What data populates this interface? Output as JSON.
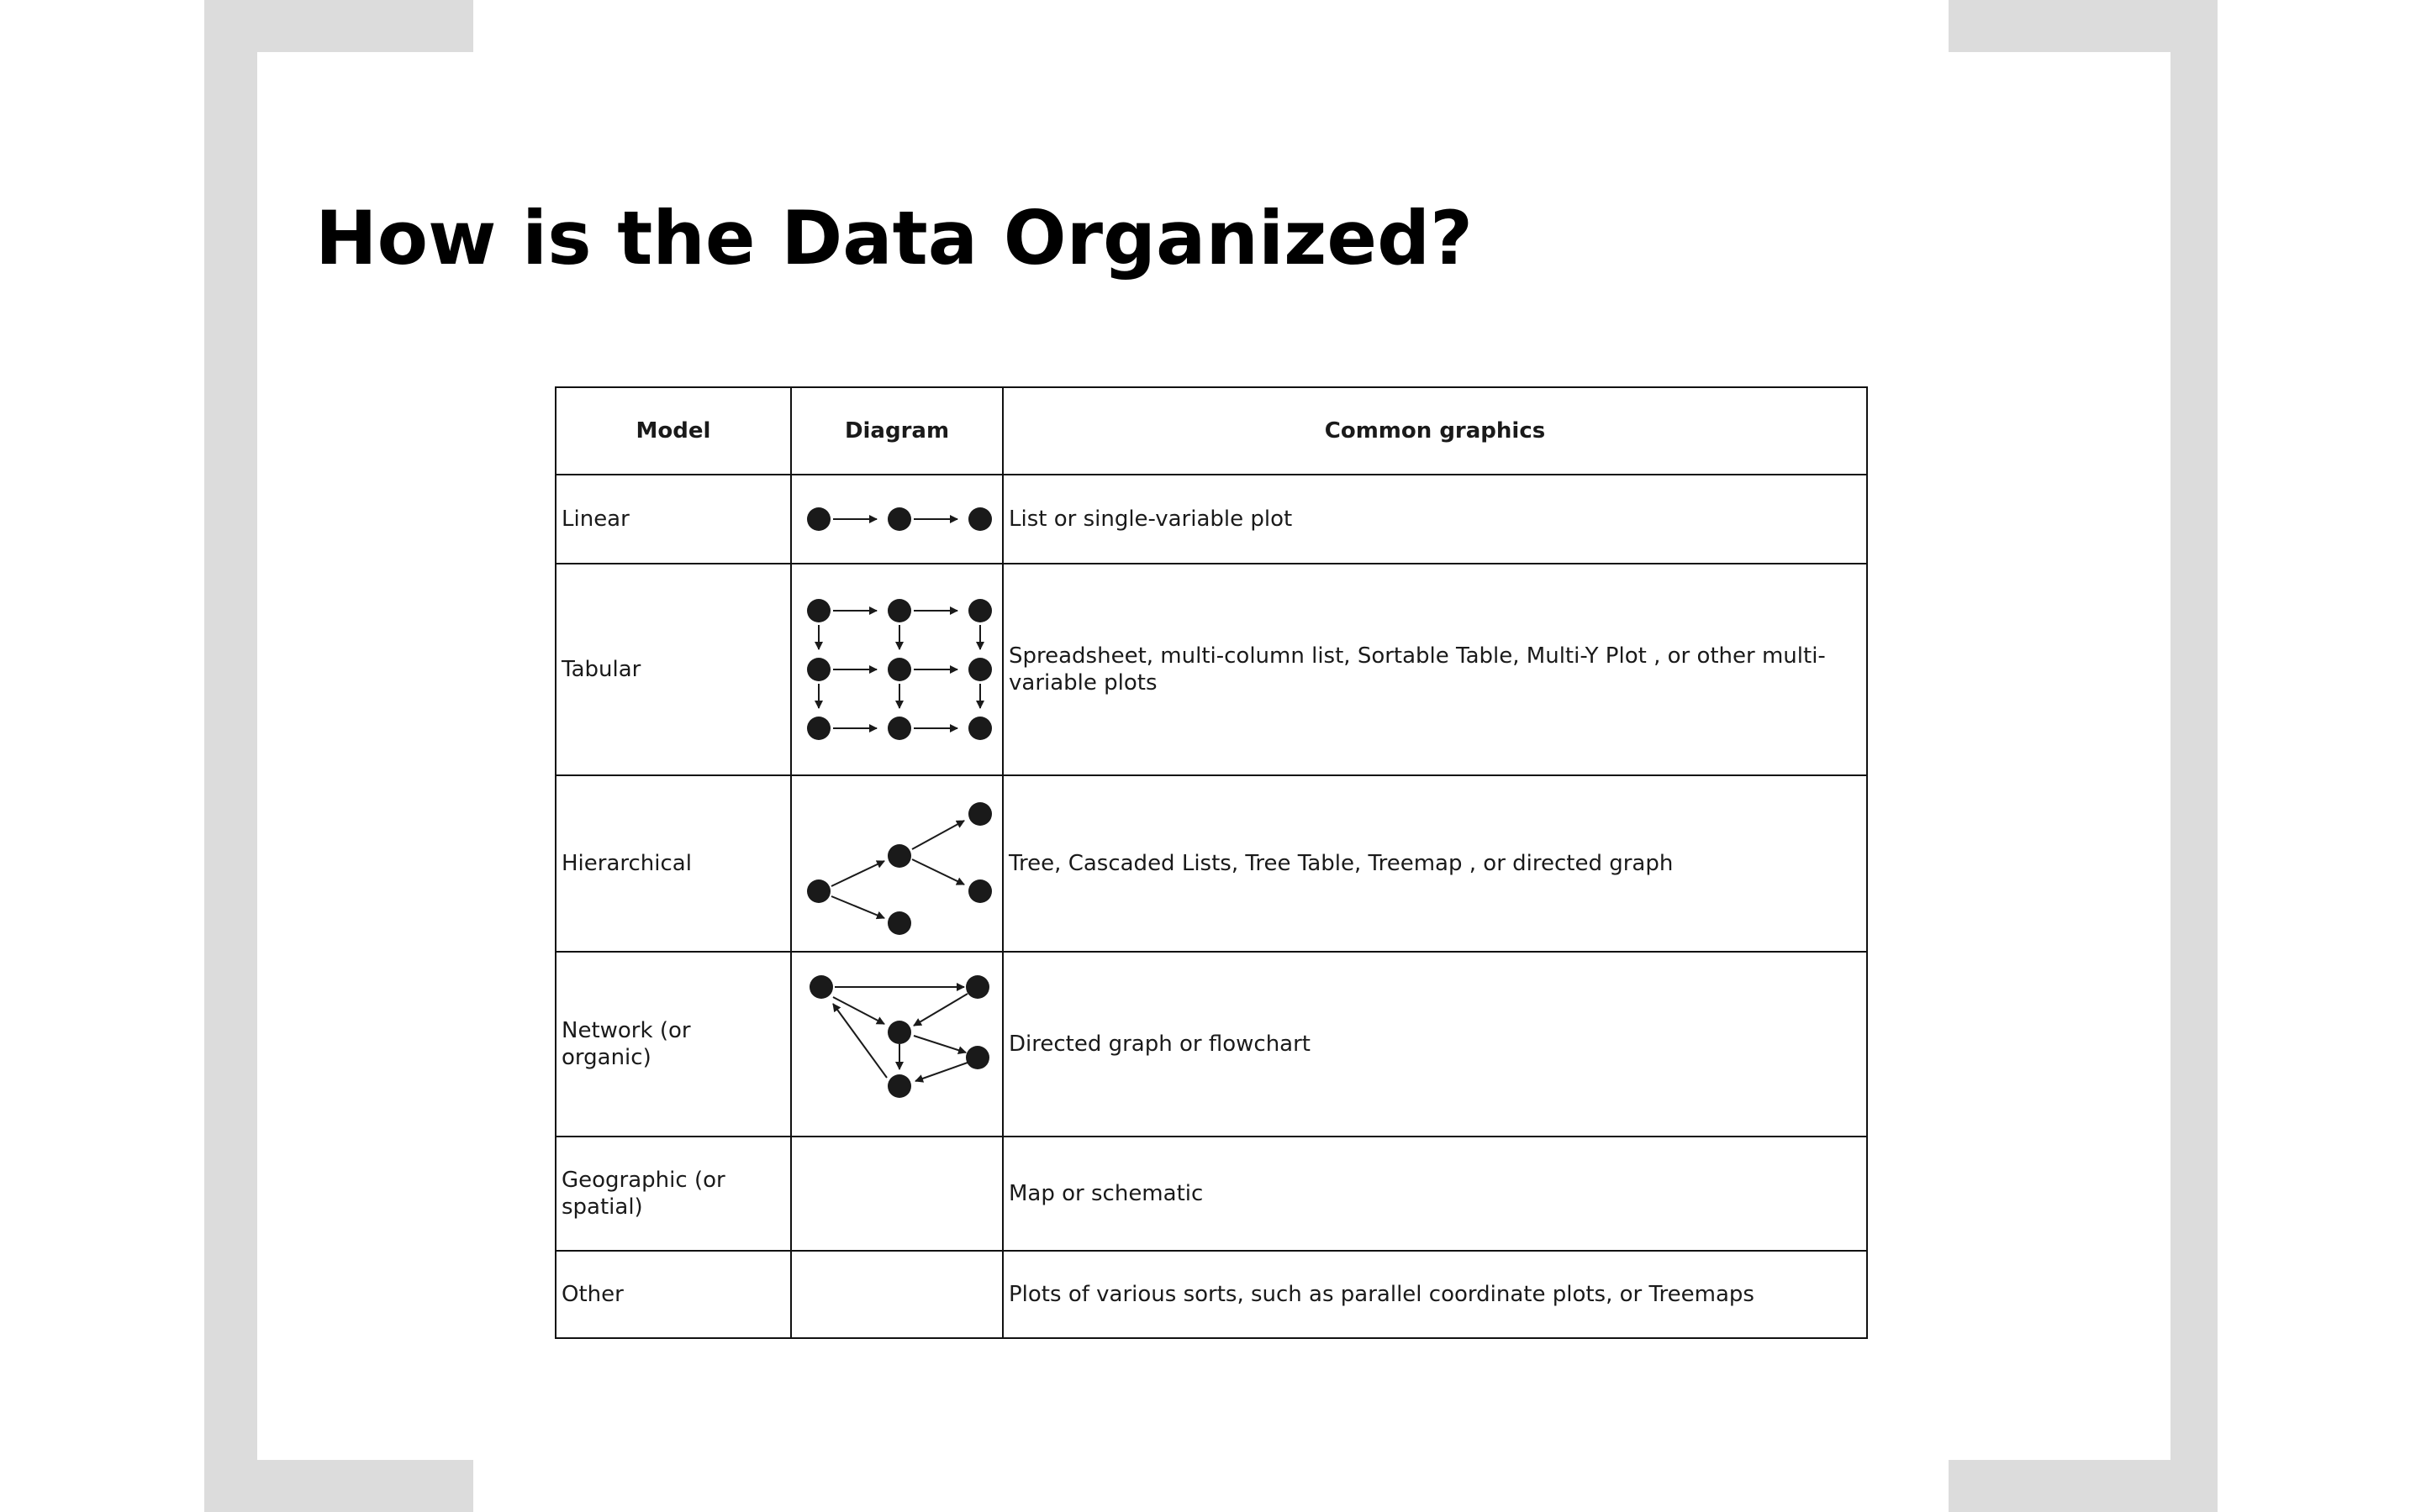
{
  "slide": {
    "title": "How is the Data Organized?"
  },
  "table": {
    "headers": {
      "model": "Model",
      "diagram": "Diagram",
      "graphics": "Common graphics"
    },
    "rows": [
      {
        "model": "Linear",
        "diagram_icon": "linear-diagram-icon",
        "graphics": "List or single-variable plot"
      },
      {
        "model": "Tabular",
        "diagram_icon": "tabular-diagram-icon",
        "graphics": "Spreadsheet, multi-column list, Sortable Table, Multi-Y Plot , or other multi-variable plots"
      },
      {
        "model": "Hierarchical",
        "diagram_icon": "hierarchical-diagram-icon",
        "graphics": "Tree, Cascaded Lists, Tree Table, Treemap , or directed graph"
      },
      {
        "model": "Network (or organic)",
        "diagram_icon": "network-diagram-icon",
        "graphics": "Directed graph or flowchart"
      },
      {
        "model": "Geographic (or spatial)",
        "diagram_icon": "",
        "graphics": "Map or schematic"
      },
      {
        "model": "Other",
        "diagram_icon": "",
        "graphics": "Plots of various sorts, such as parallel coordinate plots, or Treemaps"
      }
    ]
  },
  "colors": {
    "frame": "#dcdcdc",
    "background": "#ffffff",
    "text": "#000000",
    "node": "#1a1a1a"
  }
}
